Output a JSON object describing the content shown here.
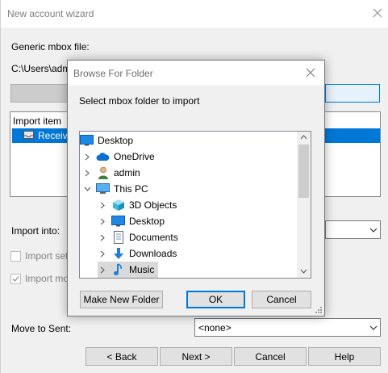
{
  "wizard": {
    "title": "New account wizard",
    "mbox_label": "Generic mbox file:",
    "path_value": "C:\\Users\\adm",
    "list_header": "Import item",
    "list_item": "Receive",
    "import_into_label": "Import into:",
    "import_set_label": "Import set",
    "import_more_label": "Import mo",
    "move_to_sent_label": "Move to Sent:",
    "move_to_sent_value": "<none>",
    "buttons": {
      "back": "< Back",
      "next": "Next >",
      "cancel": "Cancel",
      "help": "Help"
    }
  },
  "dialog": {
    "title": "Browse For Folder",
    "prompt": "Select mbox folder to import",
    "tree": [
      {
        "label": "Desktop",
        "icon": "desktop-icon"
      },
      {
        "label": "OneDrive",
        "icon": "cloud-icon"
      },
      {
        "label": "admin",
        "icon": "user-icon"
      },
      {
        "label": "This PC",
        "icon": "computer-icon"
      },
      {
        "label": "3D Objects",
        "icon": "cube-icon"
      },
      {
        "label": "Desktop",
        "icon": "desktop-icon"
      },
      {
        "label": "Documents",
        "icon": "document-icon"
      },
      {
        "label": "Downloads",
        "icon": "download-icon"
      },
      {
        "label": "Music",
        "icon": "music-icon"
      }
    ],
    "buttons": {
      "new_folder": "Make New Folder",
      "ok": "OK",
      "cancel": "Cancel"
    }
  },
  "colors": {
    "accent": "#0078d7",
    "selection": "#d9d9d9",
    "list_selected": "#0078d7",
    "folder_blue": "#1e88e5"
  }
}
